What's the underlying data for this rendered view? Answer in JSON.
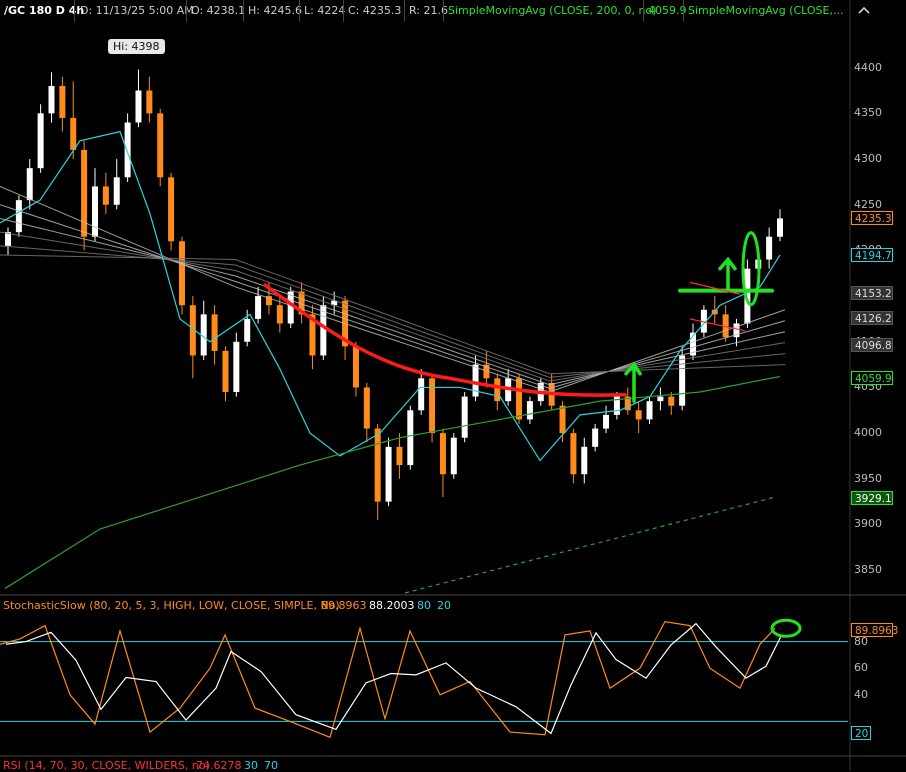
{
  "header": {
    "symbol": "/GC 180 D 4h",
    "date": "D: 11/13/25 5:00 AM",
    "open": "O: 4238.1",
    "high": "H: 4245.6",
    "low": "L: 4224",
    "close": "C: 4235.3",
    "range": "R: 21.6",
    "sma1": "SimpleMovingAvg (CLOSE, 200, 0, no)",
    "sma1_value": "4059.9",
    "sma2": "SimpleMovingAvg (CLOSE,...",
    "collapse_icon": "chevron-up-icon"
  },
  "price_axis": {
    "ticks": [
      "4400",
      "4350",
      "4300",
      "4250",
      "4200",
      "4150",
      "4100",
      "4050",
      "4000",
      "3950",
      "3900",
      "3850"
    ],
    "tags": [
      {
        "value": "4235.3",
        "bg": "#000",
        "fg": "#ff8c1a",
        "border": "#ff8c1a"
      },
      {
        "value": "4194.7",
        "bg": "#000",
        "fg": "#29d4e0",
        "border": "#29d4e0"
      },
      {
        "value": "4153.2",
        "bg": "#333",
        "fg": "#ddd",
        "border": "#555"
      },
      {
        "value": "4126.2",
        "bg": "#333",
        "fg": "#ddd",
        "border": "#555"
      },
      {
        "value": "4096.8",
        "bg": "#333",
        "fg": "#ddd",
        "border": "#555"
      },
      {
        "value": "4059.9",
        "bg": "#000",
        "fg": "#2ee02e",
        "border": "#2ee02e"
      },
      {
        "value": "3929.1",
        "bg": "#0a5a0a",
        "fg": "#fff",
        "border": "#2ee02e"
      }
    ]
  },
  "hi_label": "Hi: 4398",
  "stochastic": {
    "title": "StochasticSlow (80, 20, 5, 3, HIGH, LOW, CLOSE, SIMPLE, No)",
    "k_value": "89.8963",
    "d_value": "88.2003",
    "ob": "80",
    "os": "20",
    "ticks": [
      "80",
      "60",
      "40"
    ],
    "tag": "89.8963",
    "tag_low": "20"
  },
  "rsi": {
    "title": "RSI (14, 70, 30, CLOSE, WILDERS, no)",
    "value": "74.6278",
    "ob": "30",
    "os": "70"
  },
  "chart_data": {
    "type": "candlestick",
    "title": "/GC 180 D 4h",
    "ylim": [
      3825,
      4450
    ],
    "ohlc": [
      [
        4205,
        4225,
        4195,
        4220
      ],
      [
        4220,
        4260,
        4215,
        4255
      ],
      [
        4255,
        4300,
        4245,
        4290
      ],
      [
        4290,
        4360,
        4285,
        4350
      ],
      [
        4350,
        4395,
        4340,
        4380
      ],
      [
        4380,
        4390,
        4330,
        4345
      ],
      [
        4345,
        4385,
        4300,
        4310
      ],
      [
        4310,
        4320,
        4200,
        4215
      ],
      [
        4215,
        4290,
        4210,
        4270
      ],
      [
        4270,
        4285,
        4240,
        4250
      ],
      [
        4250,
        4300,
        4245,
        4280
      ],
      [
        4280,
        4350,
        4275,
        4340
      ],
      [
        4340,
        4398,
        4335,
        4375
      ],
      [
        4375,
        4390,
        4340,
        4350
      ],
      [
        4350,
        4355,
        4270,
        4280
      ],
      [
        4280,
        4285,
        4200,
        4210
      ],
      [
        4210,
        4215,
        4130,
        4140
      ],
      [
        4140,
        4150,
        4060,
        4085
      ],
      [
        4085,
        4145,
        4080,
        4130
      ],
      [
        4130,
        4140,
        4075,
        4090
      ],
      [
        4090,
        4095,
        4035,
        4045
      ],
      [
        4045,
        4110,
        4040,
        4100
      ],
      [
        4100,
        4135,
        4095,
        4125
      ],
      [
        4125,
        4160,
        4120,
        4150
      ],
      [
        4150,
        4165,
        4130,
        4140
      ],
      [
        4140,
        4150,
        4110,
        4120
      ],
      [
        4120,
        4160,
        4115,
        4155
      ],
      [
        4155,
        4165,
        4120,
        4130
      ],
      [
        4130,
        4140,
        4070,
        4085
      ],
      [
        4085,
        4150,
        4080,
        4140
      ],
      [
        4140,
        4155,
        4130,
        4145
      ],
      [
        4145,
        4150,
        4080,
        4095
      ],
      [
        4095,
        4100,
        4040,
        4050
      ],
      [
        4050,
        4055,
        3990,
        4005
      ],
      [
        4005,
        4010,
        3905,
        3925
      ],
      [
        3925,
        3995,
        3920,
        3985
      ],
      [
        3985,
        4000,
        3950,
        3965
      ],
      [
        3965,
        4030,
        3960,
        4025
      ],
      [
        4025,
        4070,
        4020,
        4060
      ],
      [
        4060,
        4065,
        3990,
        4000
      ],
      [
        4000,
        4005,
        3930,
        3955
      ],
      [
        3955,
        4000,
        3950,
        3995
      ],
      [
        3995,
        4045,
        3990,
        4040
      ],
      [
        4040,
        4085,
        4035,
        4075
      ],
      [
        4075,
        4090,
        4050,
        4060
      ],
      [
        4060,
        4065,
        4025,
        4035
      ],
      [
        4035,
        4070,
        4030,
        4060
      ],
      [
        4060,
        4065,
        4010,
        4015
      ],
      [
        4015,
        4040,
        4010,
        4035
      ],
      [
        4035,
        4060,
        4030,
        4055
      ],
      [
        4055,
        4065,
        4025,
        4030
      ],
      [
        4030,
        4035,
        3990,
        4000
      ],
      [
        4000,
        4005,
        3945,
        3955
      ],
      [
        3955,
        3995,
        3945,
        3985
      ],
      [
        3985,
        4010,
        3980,
        4005
      ],
      [
        4005,
        4030,
        4000,
        4020
      ],
      [
        4020,
        4045,
        4015,
        4040
      ],
      [
        4040,
        4050,
        4020,
        4025
      ],
      [
        4025,
        4035,
        4000,
        4015
      ],
      [
        4015,
        4040,
        4010,
        4035
      ],
      [
        4035,
        4050,
        4025,
        4040
      ],
      [
        4040,
        4045,
        4020,
        4030
      ],
      [
        4030,
        4095,
        4025,
        4085
      ],
      [
        4085,
        4120,
        4080,
        4110
      ],
      [
        4110,
        4140,
        4105,
        4135
      ],
      [
        4135,
        4150,
        4120,
        4130
      ],
      [
        4130,
        4140,
        4100,
        4105
      ],
      [
        4105,
        4125,
        4095,
        4120
      ],
      [
        4120,
        4190,
        4115,
        4180
      ],
      [
        4180,
        4200,
        4170,
        4190
      ],
      [
        4190,
        4225,
        4180,
        4215
      ],
      [
        4215,
        4245,
        4210,
        4235
      ]
    ],
    "sma200": {
      "name": "SimpleMovingAvg (CLOSE, 200, 0, no)",
      "value": 4059.9
    }
  }
}
